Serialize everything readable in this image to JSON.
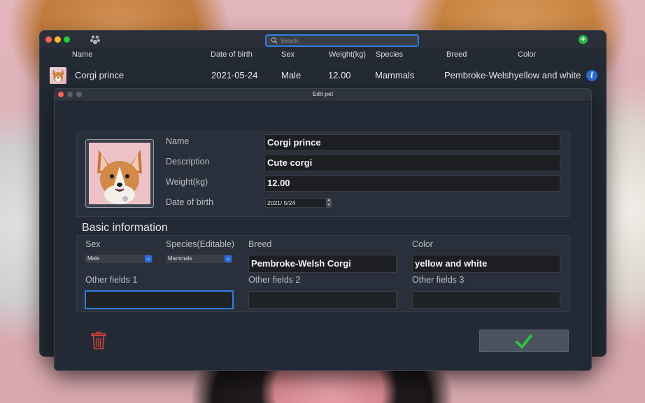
{
  "main_window": {
    "search": {
      "placeholder": "Search"
    },
    "columns": [
      "Name",
      "Date of birth",
      "Sex",
      "Weight(kg)",
      "Species",
      "Breed",
      "Color"
    ],
    "rows": [
      {
        "name": "Corgi prince",
        "date_of_birth": "2021-05-24",
        "sex": "Male",
        "weight": "12.00",
        "species": "Mammals",
        "breed": "Pembroke-Welsh",
        "color": "yellow and white"
      }
    ]
  },
  "dialog": {
    "title": "Edit pet",
    "name_label": "Name",
    "name_value": "Corgi prince",
    "description_label": "Description",
    "description_value": "Cute corgi",
    "weight_label": "Weight(kg)",
    "weight_value": "12.00",
    "dob_label": "Date of birth",
    "dob_value": "2021/  5/24",
    "basic_title": "Basic information",
    "sex_label": "Sex",
    "sex_value": "Male",
    "species_label": "Species(Editable)",
    "species_value": "Mammals",
    "breed_label": "Breed",
    "breed_value": "Pembroke-Welsh Corgi",
    "color_label": "Color",
    "color_value": "yellow and white",
    "other1_label": "Other fields 1",
    "other1_value": "",
    "other2_label": "Other fields 2",
    "other2_value": "",
    "other3_label": "Other fields 3",
    "other3_value": ""
  },
  "colors": {
    "accent": "#2f7ee0",
    "add_green": "#2ab34a",
    "delete_red": "#d9443a",
    "confirm_green": "#2fbf4a"
  }
}
